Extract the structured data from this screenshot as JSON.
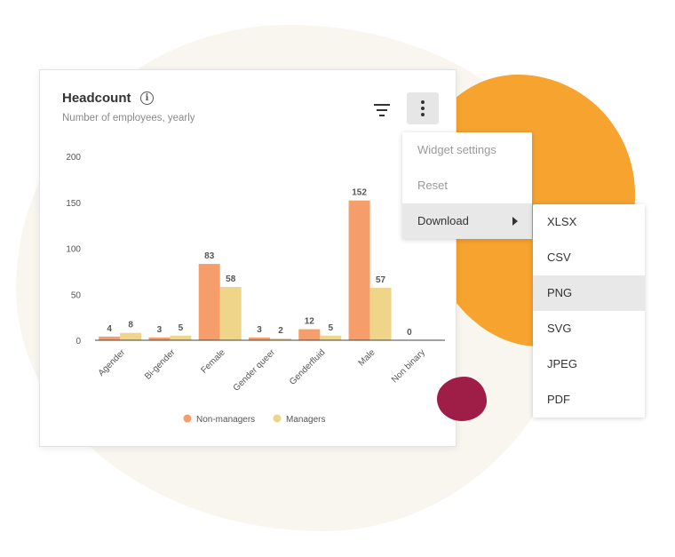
{
  "widget": {
    "title": "Headcount",
    "info_icon": "info-icon",
    "subtitle": "Number of employees, yearly",
    "filter_icon": "filter-icon",
    "more_icon": "more-vertical-icon"
  },
  "menu": {
    "items": [
      {
        "label": "Widget settings",
        "state": "muted"
      },
      {
        "label": "Reset",
        "state": "muted"
      },
      {
        "label": "Download",
        "state": "active",
        "has_submenu": true
      }
    ]
  },
  "submenu": {
    "items": [
      {
        "label": "XLSX",
        "active": false
      },
      {
        "label": "CSV",
        "active": false
      },
      {
        "label": "PNG",
        "active": true
      },
      {
        "label": "SVG",
        "active": false
      },
      {
        "label": "JPEG",
        "active": false
      },
      {
        "label": "PDF",
        "active": false
      }
    ]
  },
  "chart_data": {
    "type": "bar",
    "categories": [
      "Agender",
      "Bi-gender",
      "Female",
      "Gender queer",
      "Genderfluid",
      "Male",
      "Non binary"
    ],
    "series": [
      {
        "name": "Non-managers",
        "values": [
          4,
          3,
          83,
          3,
          12,
          152,
          0
        ],
        "color": "#f69e6b"
      },
      {
        "name": "Managers",
        "values": [
          8,
          5,
          58,
          2,
          5,
          57,
          null
        ],
        "color": "#eed589"
      }
    ],
    "data_labels": [
      [
        "4",
        "8"
      ],
      [
        "3",
        "5"
      ],
      [
        "83",
        "58"
      ],
      [
        "3",
        "2"
      ],
      [
        "12",
        "5"
      ],
      [
        "152",
        "57"
      ],
      [
        "0"
      ]
    ],
    "yticks": [
      "200",
      "150",
      "100",
      "50",
      "0"
    ],
    "ylim": [
      0,
      200
    ],
    "legend_position": "bottom",
    "grid": false
  },
  "colors": {
    "accent_orange": "#f7a32f",
    "accent_red": "#9e1e48",
    "background_blob": "#f8f6ef"
  }
}
